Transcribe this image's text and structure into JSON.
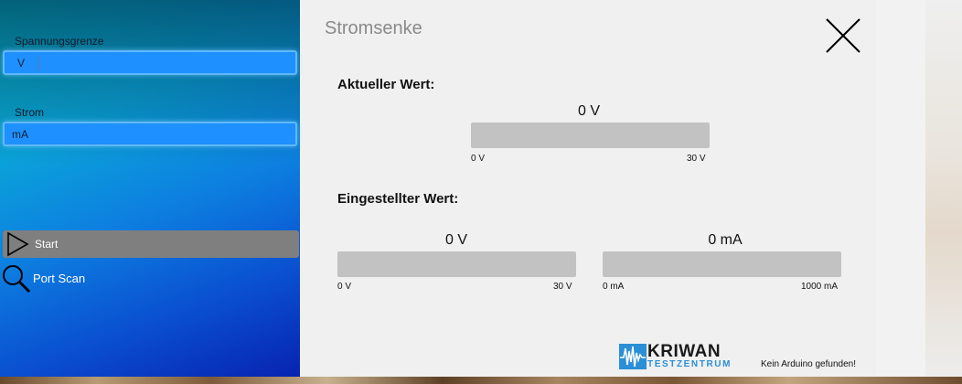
{
  "sidebar": {
    "voltage_label": "Spannungsgrenze",
    "voltage_unit": "V",
    "current_label": "Strom",
    "current_unit": "mA",
    "start_label": "Start",
    "port_scan_label": "Port Scan"
  },
  "main": {
    "title": "Stromsenke",
    "actual_heading": "Aktueller Wert:",
    "actual_value": "0 V",
    "actual_min": "0 V",
    "actual_max": "30 V",
    "actual_level": 0,
    "set_heading": "Eingestellter Wert:",
    "set_voltage_value": "0 V",
    "set_voltage_min": "0 V",
    "set_voltage_max": "30 V",
    "set_voltage_level": 0,
    "set_current_value": "0 mA",
    "set_current_min": "0 mA",
    "set_current_max": "1000 mA",
    "set_current_level": 0
  },
  "footer": {
    "logo_name": "KRIWAN",
    "logo_sub": "TESTZENTRUM",
    "status": "Kein Arduino gefunden!"
  },
  "icons": {
    "start": "play-icon",
    "scan": "magnifier-icon",
    "close": "close-icon",
    "logo": "waveform-logo-icon"
  },
  "colors": {
    "panel_gradient_start": "#07c2c6",
    "panel_gradient_end": "#0723b0",
    "field_fill": "#1e90ff",
    "start_button": "#7f7f7f",
    "bar_fill": "#c2c2c2",
    "logo_blue": "#2a8fd6"
  }
}
